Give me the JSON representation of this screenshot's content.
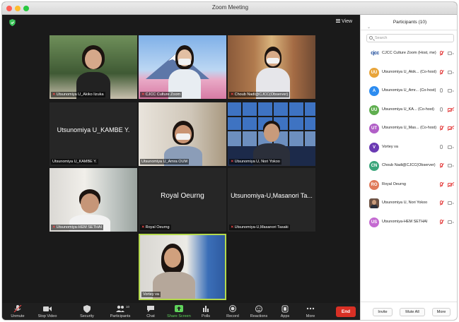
{
  "window": {
    "title": "Zoom Meeting"
  },
  "stage": {
    "view_label": "View"
  },
  "tiles": [
    {
      "name": "Utsunomiya U_Akiko Iizuka",
      "muted": true
    },
    {
      "name": "CJCC Culture Zoom",
      "muted": true
    },
    {
      "name": "Choub Nadi@CJCC(Observer)",
      "muted": true
    },
    {
      "name": "Utsunomiya U_KAMBE Y.",
      "muted": false,
      "big_name": "Utsunomiya U_KAMBE Y."
    },
    {
      "name": "Utsunomiya U_Amra OUM",
      "muted": false
    },
    {
      "name": "Utsunomiya U, Nori Yokoo",
      "muted": true
    },
    {
      "name": "Utsunomiya-HEM SETHAI",
      "muted": true
    },
    {
      "name": "Royal Oeurng",
      "muted": true,
      "big_name": "Royal Oeurng"
    },
    {
      "name": "Utsunomiya-U,Masanori Tasaki",
      "muted": true,
      "big_name": "Utsunomiya-U,Masanori Ta..."
    },
    {
      "name": "Vortey va",
      "muted": false
    }
  ],
  "toolbar": {
    "unmute": "Unmute",
    "stop_video": "Stop Video",
    "security": "Security",
    "participants": "Participants",
    "participants_count": "10",
    "chat": "Chat",
    "share_screen": "Share Screen",
    "polls": "Polls",
    "record": "Record",
    "reactions": "Reactions",
    "apps": "Apps",
    "more": "More",
    "end": "End"
  },
  "panel": {
    "title": "Participants (10)",
    "search_placeholder": "Search",
    "participants": [
      {
        "initials": "cjcc",
        "name": "CJCC Culture Zoom (Host, me)",
        "color": "#1e4c9a",
        "mic": "off",
        "cam": "on"
      },
      {
        "initials": "UU",
        "name": "Utsunomiya U_Akik... (Co-host)",
        "color": "#e8a43a",
        "mic": "off",
        "cam": "on"
      },
      {
        "initials": "A",
        "name": "Utsunomiya U_Amr... (Co-host)",
        "color": "#2d8cf0",
        "mic": "on",
        "cam": "on"
      },
      {
        "initials": "UU",
        "name": "Utsunomiya U_KA... (Co-host)",
        "color": "#5fae4f",
        "mic": "on",
        "cam": "off"
      },
      {
        "initials": "UT",
        "name": "Utsunomiya U_Mas... (Co-host)",
        "color": "#b15fc7",
        "mic": "off",
        "cam": "off"
      },
      {
        "initials": "V",
        "name": "Vortey va",
        "color": "#6a3ab3",
        "mic": "on",
        "cam": "on"
      },
      {
        "initials": "CN",
        "name": "Choub Nadi@CJCC(Observer)",
        "color": "#3aa57a",
        "mic": "off",
        "cam": "on"
      },
      {
        "initials": "RO",
        "name": "Royal Oeurng",
        "color": "#e07a5a",
        "mic": "off",
        "cam": "off"
      },
      {
        "initials": "",
        "name": "Utsunomiya U, Nori Yokoo",
        "color": "#6d5244",
        "mic": "off",
        "cam": "on"
      },
      {
        "initials": "US",
        "name": "Utsunomiya-HEM SETHAI",
        "color": "#c46ad1",
        "mic": "off",
        "cam": "on"
      }
    ],
    "invite": "Invite",
    "mute_all": "Mute All",
    "more": "More"
  }
}
